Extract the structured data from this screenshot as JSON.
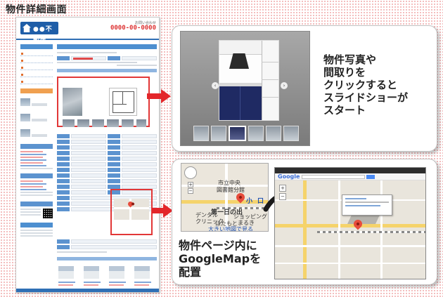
{
  "heading": "物件詳細画面",
  "site": {
    "logo_text": "●●不動産",
    "tel_label": "お問い合わせ",
    "tel": "0000-00-0000"
  },
  "callouts": {
    "slideshow_lines": [
      "物件写真や",
      "間取りを",
      "クリックすると",
      "スライドショーが",
      "スタート"
    ],
    "map_lines": [
      "物件ページ内に",
      "GoogleMapを",
      "配置"
    ]
  },
  "map_small": {
    "labels": [
      "市立中央",
      "図書館分館",
      "第一日の出",
      "デンタル",
      "クリニック",
      "ショッピング",
      "まるき",
      "ほたもと",
      "小",
      "口"
    ],
    "link": "大きい地図で見る"
  },
  "google_map": {
    "logo": "Google"
  },
  "colors": {
    "accent_red": "#e3262a",
    "site_blue": "#2f6fb5"
  }
}
